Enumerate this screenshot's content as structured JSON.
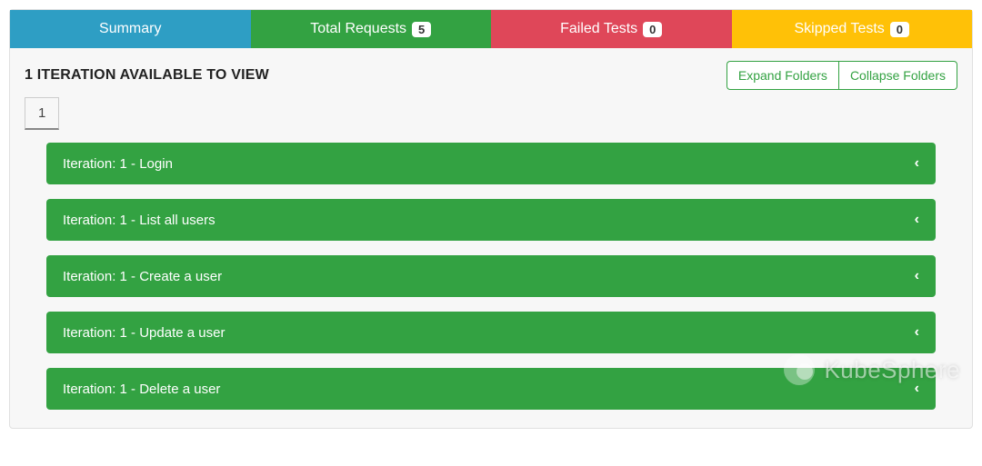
{
  "tabs": {
    "summary": {
      "label": "Summary"
    },
    "total": {
      "label": "Total Requests",
      "badge": "5"
    },
    "failed": {
      "label": "Failed Tests",
      "badge": "0"
    },
    "skipped": {
      "label": "Skipped Tests",
      "badge": "0"
    }
  },
  "header": {
    "title": "1 ITERATION AVAILABLE TO VIEW",
    "expand": "Expand Folders",
    "collapse": "Collapse Folders"
  },
  "iterationTab": "1",
  "rows": [
    {
      "label": "Iteration: 1 - Login"
    },
    {
      "label": "Iteration: 1 - List all users"
    },
    {
      "label": "Iteration: 1 - Create a user"
    },
    {
      "label": "Iteration: 1 - Update a user"
    },
    {
      "label": "Iteration: 1 - Delete a user"
    }
  ],
  "chevron": "‹",
  "watermark": "KubeSphere"
}
